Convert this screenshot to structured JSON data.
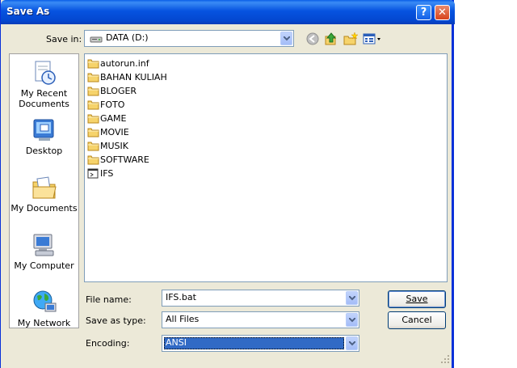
{
  "window": {
    "title": "Save As",
    "help_glyph": "?",
    "close_glyph": "✕"
  },
  "toolbar": {
    "save_in_label": "Save in:",
    "save_in_value": "DATA (D:)",
    "icons": [
      "back-icon",
      "up-folder-icon",
      "new-folder-icon",
      "views-menu-icon"
    ]
  },
  "places": [
    {
      "label_line1": "My Recent",
      "label_line2": "Documents",
      "icon": "recent-documents-icon"
    },
    {
      "label_line1": "Desktop",
      "label_line2": "",
      "icon": "desktop-icon"
    },
    {
      "label_line1": "My Documents",
      "label_line2": "",
      "icon": "my-documents-icon"
    },
    {
      "label_line1": "My Computer",
      "label_line2": "",
      "icon": "my-computer-icon"
    },
    {
      "label_line1": "My Network",
      "label_line2": "",
      "icon": "my-network-icon"
    }
  ],
  "files": [
    {
      "name": "autorun.inf",
      "type": "folder"
    },
    {
      "name": "BAHAN KULIAH",
      "type": "folder"
    },
    {
      "name": "BLOGER",
      "type": "folder"
    },
    {
      "name": "FOTO",
      "type": "folder"
    },
    {
      "name": "GAME",
      "type": "folder"
    },
    {
      "name": "MOVIE",
      "type": "folder"
    },
    {
      "name": "MUSIK",
      "type": "folder"
    },
    {
      "name": "SOFTWARE",
      "type": "folder"
    },
    {
      "name": "IFS",
      "type": "batch-file"
    }
  ],
  "form": {
    "file_name_label": "File name:",
    "file_name_value": "IFS.bat",
    "save_as_type_label": "Save as type:",
    "save_as_type_value": "All Files",
    "encoding_label": "Encoding:",
    "encoding_value": "ANSI"
  },
  "buttons": {
    "save": "Save",
    "cancel": "Cancel"
  },
  "colors": {
    "title_bar": "#0653e0",
    "selection": "#316ac5",
    "dialog_bg": "#ece9d8"
  }
}
